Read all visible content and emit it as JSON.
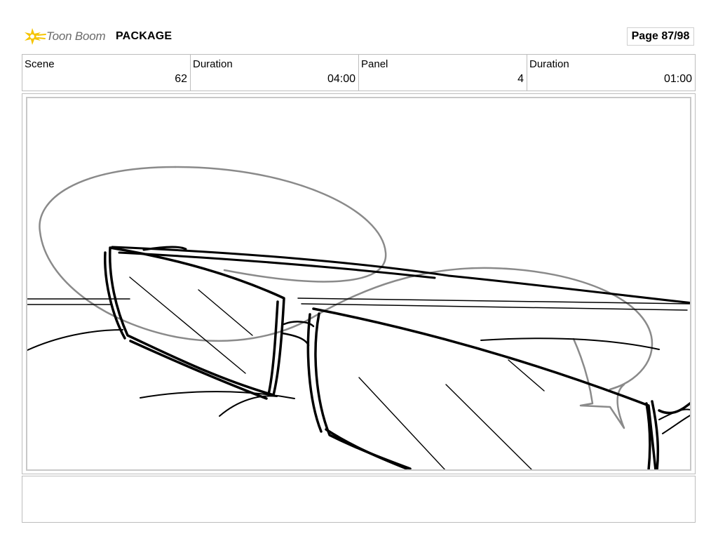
{
  "header": {
    "brand": "Toon Boom",
    "project": "PACKAGE",
    "page": "Page 87/98"
  },
  "info": [
    {
      "label": "Scene",
      "value": "62"
    },
    {
      "label": "Duration",
      "value": "04:00"
    },
    {
      "label": "Panel",
      "value": "4"
    },
    {
      "label": "Duration",
      "value": "01:00"
    }
  ],
  "panel": {
    "image": "sketch-sunglasses"
  },
  "notes": {
    "text": ""
  },
  "colors": {
    "brand_yellow": "#f5c400",
    "brand_gray": "#6b6b6b",
    "border": "#bdbdbd",
    "sketch_line": "#000000",
    "sketch_guide": "#8a8a8a"
  }
}
